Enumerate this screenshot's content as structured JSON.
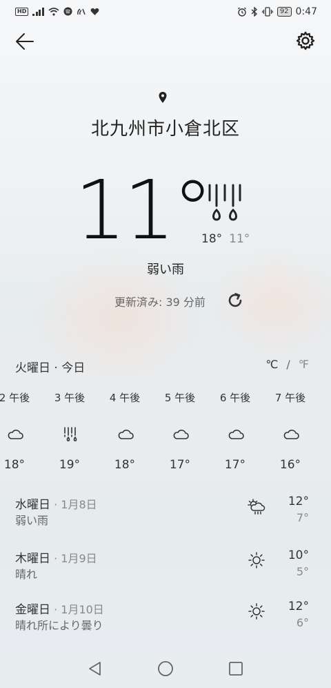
{
  "status_bar": {
    "hd": "HD",
    "battery": "92",
    "time": "0:47"
  },
  "location": {
    "city": "北九州市小倉北区"
  },
  "current": {
    "temperature": "11°",
    "high": "18°",
    "low": "11°",
    "condition": "弱い雨",
    "updated": "更新済み: 39 分前"
  },
  "day_header": {
    "day": "火曜日 · 今日",
    "celsius": "℃",
    "separator": "/",
    "fahrenheit": "℉"
  },
  "hourly": [
    {
      "label": "2 午後",
      "temp": "18°",
      "icon": "cloudy-icon"
    },
    {
      "label": "3 午後",
      "temp": "19°",
      "icon": "rain-icon"
    },
    {
      "label": "4 午後",
      "temp": "18°",
      "icon": "cloudy-icon"
    },
    {
      "label": "5 午後",
      "temp": "17°",
      "icon": "cloudy-icon"
    },
    {
      "label": "6 午後",
      "temp": "17°",
      "icon": "cloudy-icon"
    },
    {
      "label": "7 午後",
      "temp": "16°",
      "icon": "cloudy-icon"
    }
  ],
  "daily": [
    {
      "day": "水曜日",
      "date": " · 1月8日",
      "condition": "弱い雨",
      "high": "12°",
      "low": "7°",
      "icon": "sun-cloud-rain-icon"
    },
    {
      "day": "木曜日",
      "date": " · 1月9日",
      "condition": "晴れ",
      "high": "10°",
      "low": "5°",
      "icon": "sun-icon"
    },
    {
      "day": "金曜日",
      "date": " · 1月10日",
      "condition": "晴れ所により曇り",
      "high": "12°",
      "low": "6°",
      "icon": "sun-icon"
    }
  ]
}
